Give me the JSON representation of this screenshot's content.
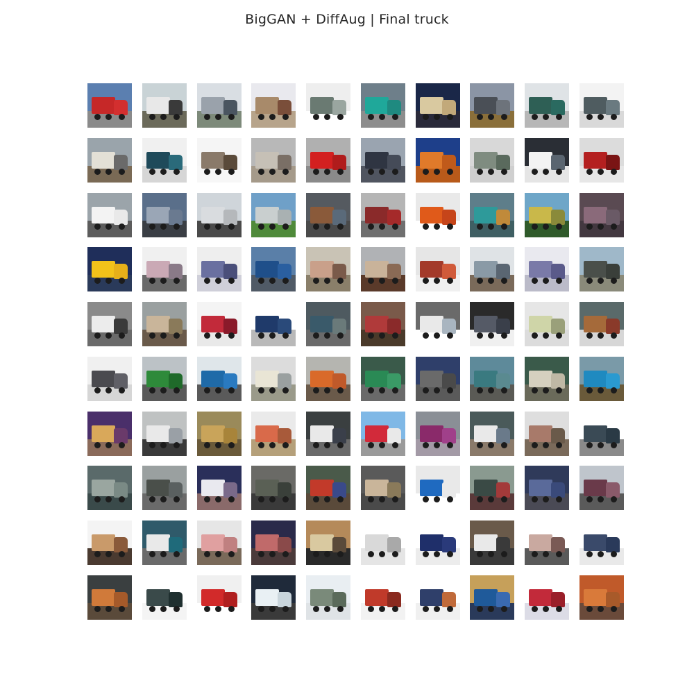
{
  "title": "BigGAN + DiffAug | Final truck",
  "grid": {
    "rows": 10,
    "cols": 10,
    "tiles": [
      {
        "sky": "#5b7fb0",
        "ground": "#8a8a8a",
        "body": "#c62828",
        "cab": "#d32f2f"
      },
      {
        "sky": "#c9d3d6",
        "ground": "#6b6a5a",
        "body": "#e8e8e8",
        "cab": "#3a3a3a"
      },
      {
        "sky": "#d9dee3",
        "ground": "#7d8a7a",
        "body": "#9aa2ab",
        "cab": "#4a5560"
      },
      {
        "sky": "#e9e9ee",
        "ground": "#b7a48b",
        "body": "#a88a6a",
        "cab": "#7a4e3a"
      },
      {
        "sky": "#eeeeee",
        "ground": "#ffffff",
        "body": "#6a7a72",
        "cab": "#9aa6a0"
      },
      {
        "sky": "#6e7f8a",
        "ground": "#8d8d8d",
        "body": "#1fa89a",
        "cab": "#1f8a80"
      },
      {
        "sky": "#1a2748",
        "ground": "#2a2a3a",
        "body": "#d9c9a0",
        "cab": "#c2a97a"
      },
      {
        "sky": "#8b95a5",
        "ground": "#8a6f3a",
        "body": "#4a4f56",
        "cab": "#6d737b"
      },
      {
        "sky": "#dfe3e6",
        "ground": "#b7b7b7",
        "body": "#2e5f55",
        "cab": "#2a6a60"
      },
      {
        "sky": "#f3f3f3",
        "ground": "#d9d9d9",
        "body": "#4f5c60",
        "cab": "#6a7a80"
      },
      {
        "sky": "#9aa4ab",
        "ground": "#7a6a55",
        "body": "#e3e0d6",
        "cab": "#6a6a6a"
      },
      {
        "sky": "#f0f0f0",
        "ground": "#d6d6d6",
        "body": "#1f4a5a",
        "cab": "#2a6a7a"
      },
      {
        "sky": "#f5f5f5",
        "ground": "#f7f7f7",
        "body": "#8a7a6a",
        "cab": "#5a4a3a"
      },
      {
        "sky": "#b8b8b8",
        "ground": "#a59a8a",
        "body": "#c6c0b6",
        "cab": "#7a6f66"
      },
      {
        "sky": "#b0b0b0",
        "ground": "#8a8a8a",
        "body": "#d32020",
        "cab": "#b01c1c"
      },
      {
        "sky": "#9aa4b0",
        "ground": "#505560",
        "body": "#2f3542",
        "cab": "#454b58"
      },
      {
        "sky": "#1e3f8a",
        "ground": "#b85a1a",
        "body": "#e07a2a",
        "cab": "#c05a1a"
      },
      {
        "sky": "#d8d8d8",
        "ground": "#cfcfcf",
        "body": "#7f8c80",
        "cab": "#5a6a5d"
      },
      {
        "sky": "#2a2e35",
        "ground": "#e5e5e5",
        "body": "#f3f3f3",
        "cab": "#5a6570"
      },
      {
        "sky": "#dcdcdc",
        "ground": "#e7e7e7",
        "body": "#b42020",
        "cab": "#7a1414"
      },
      {
        "sky": "#9ba4aa",
        "ground": "#5c5c5c",
        "body": "#f3f3f3",
        "cab": "#e9e9e9"
      },
      {
        "sky": "#5a6f8a",
        "ground": "#3a3e44",
        "body": "#9aa6b6",
        "cab": "#6a7a90"
      },
      {
        "sky": "#cfd5da",
        "ground": "#4a4a4a",
        "body": "#d9dcdf",
        "cab": "#b5b8bb"
      },
      {
        "sky": "#6fa0c8",
        "ground": "#4f8a3a",
        "body": "#c9cfcf",
        "cab": "#a9b1b2"
      },
      {
        "sky": "#555a60",
        "ground": "#4a4a4a",
        "body": "#8a5a3a",
        "cab": "#5a6a7a"
      },
      {
        "sky": "#b5b5b5",
        "ground": "#6f6f6f",
        "body": "#8a2a2a",
        "cab": "#a52a2a"
      },
      {
        "sky": "#e9e9e9",
        "ground": "#ffffff",
        "body": "#e05a1a",
        "cab": "#c6451a"
      },
      {
        "sky": "#5e7e8a",
        "ground": "#3f5f63",
        "body": "#2e9a9a",
        "cab": "#c08a3a"
      },
      {
        "sky": "#6ea6c8",
        "ground": "#2f5a2a",
        "body": "#c9b84a",
        "cab": "#8a8a3a"
      },
      {
        "sky": "#5a4a52",
        "ground": "#433840",
        "body": "#8a6a7a",
        "cab": "#6a5a66"
      },
      {
        "sky": "#1f2e5a",
        "ground": "#2a3a5a",
        "body": "#f2c21a",
        "cab": "#e6b01a"
      },
      {
        "sky": "#f0f0f0",
        "ground": "#6a6a6a",
        "body": "#caa9b5",
        "cab": "#8a7a88"
      },
      {
        "sky": "#eeeeee",
        "ground": "#cfcfd9",
        "body": "#6a70a0",
        "cab": "#4a4f7a"
      },
      {
        "sky": "#5a7fa8",
        "ground": "#505a66",
        "body": "#1f4f8a",
        "cab": "#2a5fa0"
      },
      {
        "sky": "#c9c3b5",
        "ground": "#8a7f6a",
        "body": "#c9a08a",
        "cab": "#7a5a4a"
      },
      {
        "sky": "#b0b2b5",
        "ground": "#5a3a2a",
        "body": "#c9b39a",
        "cab": "#8a6a55"
      },
      {
        "sky": "#e6e6e6",
        "ground": "#f0f0f0",
        "body": "#a33a2a",
        "cab": "#d05a3a"
      },
      {
        "sky": "#dfe3e6",
        "ground": "#7a6a5a",
        "body": "#8a9aa6",
        "cab": "#5a6672"
      },
      {
        "sky": "#e9e9ef",
        "ground": "#bbbbc9",
        "body": "#7a7aa8",
        "cab": "#5a5a8a"
      },
      {
        "sky": "#9fb8c9",
        "ground": "#8a8a7a",
        "body": "#4a4f4a",
        "cab": "#3a3f3a"
      },
      {
        "sky": "#8a8a8a",
        "ground": "#6a6a6a",
        "body": "#ececec",
        "cab": "#3a3a3a"
      },
      {
        "sky": "#9aa0a0",
        "ground": "#6a5a4a",
        "body": "#c9b59a",
        "cab": "#8a7a5a"
      },
      {
        "sky": "#f4f4f4",
        "ground": "#e9e9e9",
        "body": "#c22a3a",
        "cab": "#8a1a2a"
      },
      {
        "sky": "#ffffff",
        "ground": "#b9b9b9",
        "body": "#1f3a6a",
        "cab": "#2a4a7a"
      },
      {
        "sky": "#4e5a60",
        "ground": "#6a6a6a",
        "body": "#3a5a6a",
        "cab": "#6a7a7a"
      },
      {
        "sky": "#7a5a4a",
        "ground": "#4a3a2a",
        "body": "#b03a3a",
        "cab": "#8a2a2a"
      },
      {
        "sky": "#6a6a6a",
        "ground": "#ffffff",
        "body": "#e9e9e9",
        "cab": "#a9b5c0"
      },
      {
        "sky": "#2a2a2a",
        "ground": "#f0f0f0",
        "body": "#555a66",
        "cab": "#3a3f4a"
      },
      {
        "sky": "#e6e6e6",
        "ground": "#dcdcdc",
        "body": "#cfd5a8",
        "cab": "#9aa07a"
      },
      {
        "sky": "#5a6a6a",
        "ground": "#d7d7d7",
        "body": "#a56a3a",
        "cab": "#8a3a2a"
      },
      {
        "sky": "#f0f0f0",
        "ground": "#d6d6d6",
        "body": "#4a4a4f",
        "cab": "#5f5f66"
      },
      {
        "sky": "#bcc2c6",
        "ground": "#5a5a5a",
        "body": "#2e8a3a",
        "cab": "#1f6a2a"
      },
      {
        "sky": "#dfe6ea",
        "ground": "#5a5a5a",
        "body": "#1f6aa8",
        "cab": "#2a7ac0"
      },
      {
        "sky": "#dcdcdc",
        "ground": "#9a9a8a",
        "body": "#e9e5d5",
        "cab": "#9aa0a0"
      },
      {
        "sky": "#b5b5b0",
        "ground": "#6a5a4a",
        "body": "#d96a2a",
        "cab": "#c05a2a"
      },
      {
        "sky": "#3a5a4a",
        "ground": "#6a6a6a",
        "body": "#2a8a55",
        "cab": "#3a9a66"
      },
      {
        "sky": "#2f3f6a",
        "ground": "#5a5a5a",
        "body": "#6a6a6a",
        "cab": "#4a4a4a"
      },
      {
        "sky": "#5e8a9a",
        "ground": "#5a5a55",
        "body": "#3a7a80",
        "cab": "#5a8a90"
      },
      {
        "sky": "#3a5a4a",
        "ground": "#6a6a5a",
        "body": "#d5d0bf",
        "cab": "#bfb8a5"
      },
      {
        "sky": "#7a9aa8",
        "ground": "#6a5a3a",
        "body": "#1f8ac0",
        "cab": "#2a9ad0"
      },
      {
        "sky": "#4a2f6a",
        "ground": "#8a6a5a",
        "body": "#d9a85a",
        "cab": "#6a3a6a"
      },
      {
        "sky": "#bfc2c2",
        "ground": "#3a3a3a",
        "body": "#e9e9e9",
        "cab": "#9aa0a6"
      },
      {
        "sky": "#9a8a5a",
        "ground": "#6a5a3a",
        "body": "#c9a45a",
        "cab": "#a8843a"
      },
      {
        "sky": "#eaeaea",
        "ground": "#b5a07a",
        "body": "#d96a4a",
        "cab": "#a85a3a"
      },
      {
        "sky": "#3a3f40",
        "ground": "#6a6a6a",
        "body": "#e9e9e9",
        "cab": "#3a3f4a"
      },
      {
        "sky": "#7fb8e6",
        "ground": "#9a9a9a",
        "body": "#d22a3a",
        "cab": "#e9e9e9"
      },
      {
        "sky": "#8a8f96",
        "ground": "#a39aa6",
        "body": "#8a2a6a",
        "cab": "#a0408a"
      },
      {
        "sky": "#4a5a5a",
        "ground": "#8a7a6a",
        "body": "#e9e9e9",
        "cab": "#6a7a8a"
      },
      {
        "sky": "#dedede",
        "ground": "#7a6a5a",
        "body": "#a87a6a",
        "cab": "#6a5a4a"
      },
      {
        "sky": "#ffffff",
        "ground": "#8a8a8a",
        "body": "#3a4a55",
        "cab": "#2a3a45"
      },
      {
        "sky": "#5a6a6a",
        "ground": "#3a4a4a",
        "body": "#9aa6a0",
        "cab": "#7a8a85"
      },
      {
        "sky": "#9aa0a0",
        "ground": "#6a6a6a",
        "body": "#4a4f4a",
        "cab": "#5a6060"
      },
      {
        "sky": "#2a2f5a",
        "ground": "#8a6a6a",
        "body": "#e9e9ef",
        "cab": "#7a6a8a"
      },
      {
        "sky": "#6a6a66",
        "ground": "#3a3a3a",
        "body": "#5a6055",
        "cab": "#3a403a"
      },
      {
        "sky": "#4a5a4a",
        "ground": "#5a4a3a",
        "body": "#c23a2a",
        "cab": "#3a4a8a"
      },
      {
        "sky": "#5a5a5a",
        "ground": "#4a4a4a",
        "body": "#c9b59a",
        "cab": "#8a7a5a"
      },
      {
        "sky": "#e9e9e9",
        "ground": "#ffffff",
        "body": "#1f6ac0",
        "cab": "#e9e9e9"
      },
      {
        "sky": "#8a9a90",
        "ground": "#5a3a3a",
        "body": "#3a4a45",
        "cab": "#a33a3a"
      },
      {
        "sky": "#2f3a5a",
        "ground": "#4a4a55",
        "body": "#5a6a9a",
        "cab": "#3a4a7a"
      },
      {
        "sky": "#bfc5cc",
        "ground": "#5a5a5a",
        "body": "#6a3a4a",
        "cab": "#8a5a6a"
      },
      {
        "sky": "#f4f4f4",
        "ground": "#4a3a30",
        "body": "#c99a6a",
        "cab": "#8a5a3a"
      },
      {
        "sky": "#2f5a6a",
        "ground": "#6a6a6a",
        "body": "#e9e9e9",
        "cab": "#1f6a7a"
      },
      {
        "sky": "#e6e6e6",
        "ground": "#7a6a5a",
        "body": "#e0a0a0",
        "cab": "#c08080"
      },
      {
        "sky": "#2a2a4a",
        "ground": "#4a3a3a",
        "body": "#c06a6a",
        "cab": "#8a4a4a"
      },
      {
        "sky": "#b58a5a",
        "ground": "#2a2a2a",
        "body": "#d9c9a0",
        "cab": "#5a4a3a"
      },
      {
        "sky": "#ffffff",
        "ground": "#e5e5e5",
        "body": "#d9d9d9",
        "cab": "#a9a9a9"
      },
      {
        "sky": "#ffffff",
        "ground": "#ececec",
        "body": "#1f2f6a",
        "cab": "#2a3a7a"
      },
      {
        "sky": "#6a5a4a",
        "ground": "#3a3a3a",
        "body": "#e9e9e9",
        "cab": "#3a3a3a"
      },
      {
        "sky": "#ffffff",
        "ground": "#5a5a5a",
        "body": "#c9a9a0",
        "cab": "#7a5a55"
      },
      {
        "sky": "#ffffff",
        "ground": "#e9e9e9",
        "body": "#3a4a6a",
        "cab": "#2a3a5a"
      },
      {
        "sky": "#3a3f40",
        "ground": "#5a4a3a",
        "body": "#d07a3a",
        "cab": "#a55a2a"
      },
      {
        "sky": "#ffffff",
        "ground": "#f4f4f4",
        "body": "#3a4a4a",
        "cab": "#1f2f2f"
      },
      {
        "sky": "#f0f0f0",
        "ground": "#ffffff",
        "body": "#d22a2a",
        "cab": "#b01f1f"
      },
      {
        "sky": "#1f2a3a",
        "ground": "#3a3a3a",
        "body": "#e9f0f4",
        "cab": "#c9d5dc"
      },
      {
        "sky": "#e9eef2",
        "ground": "#dfe3e6",
        "body": "#7a8a7a",
        "cab": "#5a6a5a"
      },
      {
        "sky": "#ffffff",
        "ground": "#f2f2f2",
        "body": "#c03a2a",
        "cab": "#8a2a1f"
      },
      {
        "sky": "#ffffff",
        "ground": "#f0f0f0",
        "body": "#2f3f6a",
        "cab": "#c06a3a"
      },
      {
        "sky": "#c6a05a",
        "ground": "#2a3a5a",
        "body": "#1f5a9a",
        "cab": "#3a6ab0"
      },
      {
        "sky": "#ffffff",
        "ground": "#dcdce6",
        "body": "#c22a3a",
        "cab": "#9a1f2a"
      },
      {
        "sky": "#c05a2a",
        "ground": "#6a4a3a",
        "body": "#d97a3a",
        "cab": "#a85a2a"
      }
    ]
  }
}
